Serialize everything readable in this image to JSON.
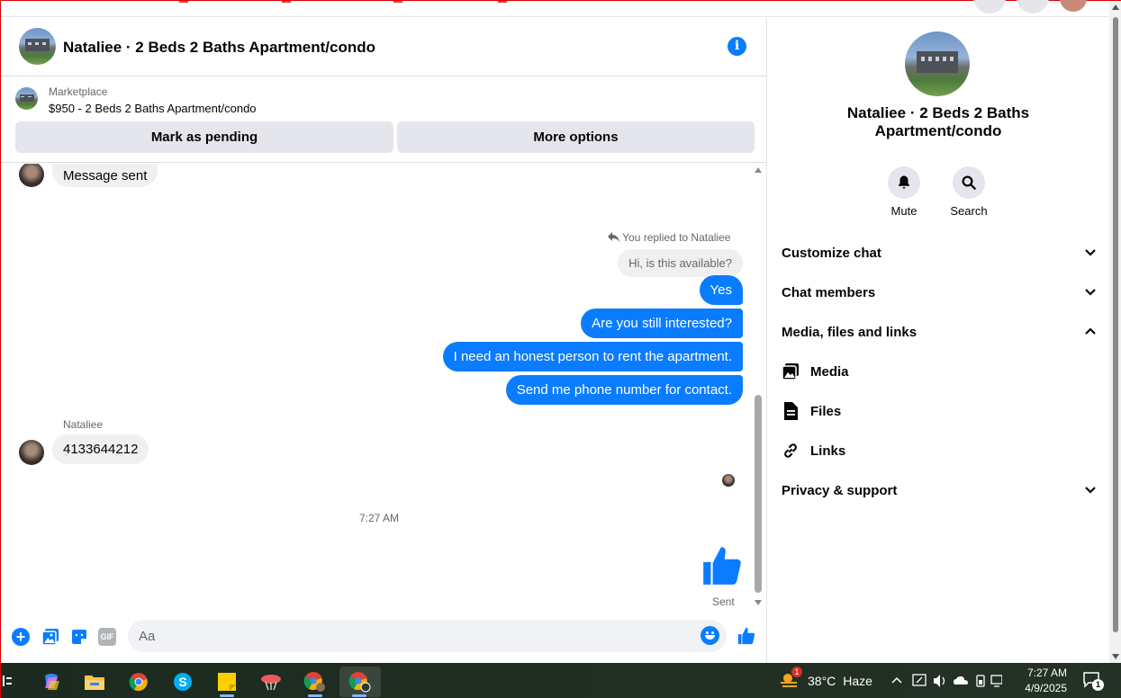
{
  "header": {
    "title": "Nataliee · 2 Beds 2 Baths Apartment/condo"
  },
  "marketplace": {
    "label": "Marketplace",
    "listing": "$950 - 2 Beds 2 Baths Apartment/condo",
    "pending_button": "Mark as pending",
    "more_button": "More options"
  },
  "messages": {
    "partial_top": "Message sent",
    "reply_context": "You replied to Nataliee",
    "reply_quote": "Hi, is this available?",
    "outgoing": [
      "Yes",
      "Are you still interested?",
      "I need an honest person to rent the apartment.",
      "Send me phone number for contact."
    ],
    "sender_name": "Nataliee",
    "incoming_number": "4133644212",
    "timestamp": "7:27 AM",
    "sent_status": "Sent"
  },
  "composer": {
    "placeholder": "Aa",
    "gif_label": "GIF"
  },
  "right_panel": {
    "name": "Nataliee · 2 Beds 2 Baths Apartment/condo",
    "mute_label": "Mute",
    "search_label": "Search",
    "sections": {
      "customize": "Customize chat",
      "members": "Chat members",
      "media_files_links": "Media, files and links",
      "privacy": "Privacy & support"
    },
    "sub_items": {
      "media": "Media",
      "files": "Files",
      "links": "Links"
    }
  },
  "taskbar": {
    "temperature": "38°C",
    "weather": "Haze",
    "weather_badge": "1",
    "time": "7:27 AM",
    "date": "4/9/2025",
    "notification_count": "1"
  },
  "colors": {
    "messenger_blue": "#0a7cff",
    "bubble_gray": "#f0f0f0",
    "button_gray": "#e4e6eb"
  }
}
